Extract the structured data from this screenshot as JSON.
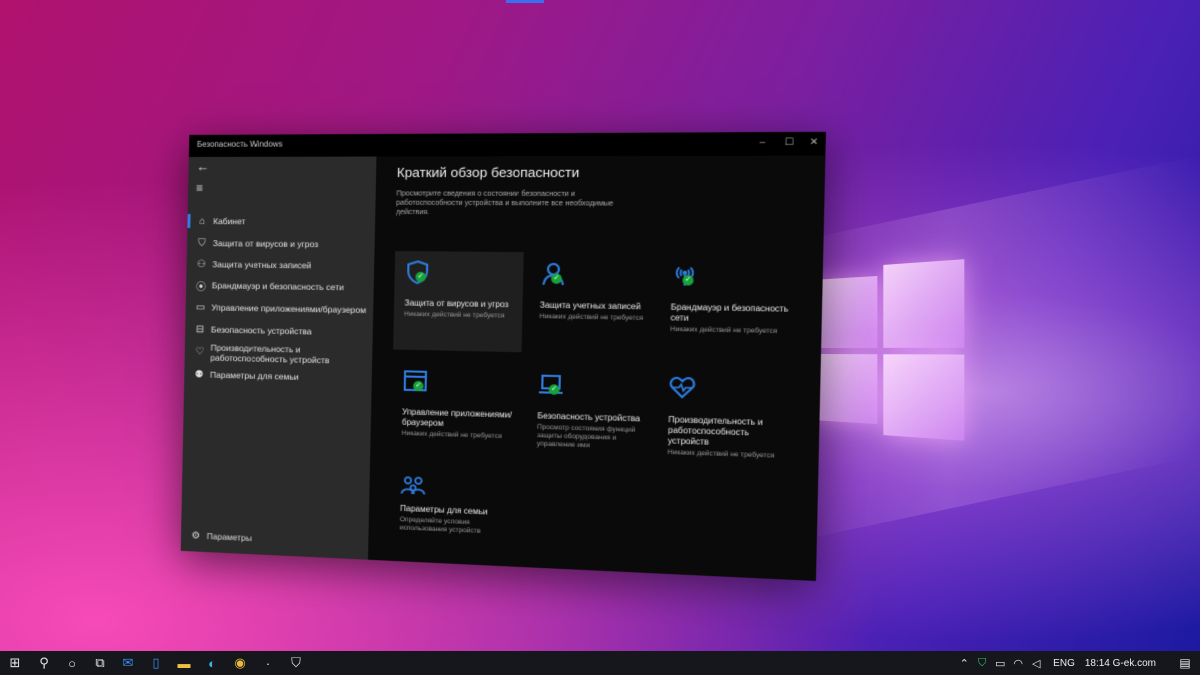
{
  "window": {
    "title": "Безопасность Windows",
    "controls": {
      "minimize": "–",
      "maximize": "☐",
      "close": "✕"
    }
  },
  "sidebar": {
    "back_glyph": "←",
    "menu_glyph": "≡",
    "items": [
      {
        "label": "Кабинет",
        "icon": "home-icon",
        "glyph": "⌂"
      },
      {
        "label": "Защита от вирусов и угроз",
        "icon": "shield-icon",
        "glyph": "⛉"
      },
      {
        "label": "Защита учетных записей",
        "icon": "person-icon",
        "glyph": "⚇"
      },
      {
        "label": "Брандмауэр и безопасность сети",
        "icon": "network-icon",
        "glyph": "⦿"
      },
      {
        "label": "Управление приложениями/браузером",
        "icon": "app-browser-icon",
        "glyph": "▭"
      },
      {
        "label": "Безопасность устройства",
        "icon": "laptop-icon",
        "glyph": "⊟"
      },
      {
        "label": "Производительность и работоспособность устройств",
        "icon": "heart-icon",
        "glyph": "♡"
      },
      {
        "label": "Параметры для семьи",
        "icon": "family-icon",
        "glyph": "⚉"
      }
    ],
    "settings": {
      "label": "Параметры",
      "icon": "gear-icon",
      "glyph": "⚙"
    }
  },
  "main": {
    "title": "Краткий обзор безопасности",
    "description": "Просмотрите сведения о состоянии безопасности и работоспособности устройства и выполните все необходимые действия.",
    "tiles": [
      {
        "title": "Защита от вирусов и угроз",
        "status": "Никаких действий не требуется",
        "icon": "shield-icon"
      },
      {
        "title": "Защита учетных записей",
        "status": "Никаких действий не требуется",
        "icon": "person-icon"
      },
      {
        "title": "Брандмауэр и безопасность сети",
        "status": "Никаких действий не требуется",
        "icon": "network-icon"
      },
      {
        "title": "Управление приложениями/браузером",
        "status": "Никаких действий не требуется",
        "icon": "app-browser-icon"
      },
      {
        "title": "Безопасность устройства",
        "status": "Просмотр состояния функций защиты оборудования и управление ими",
        "icon": "laptop-icon"
      },
      {
        "title": "Производительность и работоспособность устройств",
        "status": "Никаких действий не требуется",
        "icon": "heart-icon"
      },
      {
        "title": "Параметры для семьи",
        "status": "Определяйте условия использования устройств",
        "icon": "family-icon"
      }
    ],
    "check_glyph": "✓"
  },
  "taskbar": {
    "left_icons": [
      {
        "name": "start-icon",
        "glyph": "⊞"
      },
      {
        "name": "search-icon",
        "glyph": "⚲"
      },
      {
        "name": "cortana-icon",
        "glyph": "○"
      },
      {
        "name": "task-view-icon",
        "glyph": "⧉"
      },
      {
        "name": "mail-icon",
        "glyph": "✉"
      },
      {
        "name": "phone-icon",
        "glyph": "▯"
      },
      {
        "name": "file-explorer-icon",
        "glyph": "▬"
      },
      {
        "name": "edge-icon",
        "glyph": "◐"
      },
      {
        "name": "chrome-icon",
        "glyph": "◉"
      },
      {
        "name": "app-dot-icon",
        "glyph": "·"
      },
      {
        "name": "windows-security-icon",
        "glyph": "⛉"
      }
    ],
    "tray_icons": [
      {
        "name": "chevron-up-icon",
        "glyph": "⌃"
      },
      {
        "name": "security-tray-icon",
        "glyph": "⛉"
      },
      {
        "name": "battery-icon",
        "glyph": "▭"
      },
      {
        "name": "wifi-icon",
        "glyph": "◠"
      },
      {
        "name": "volume-icon",
        "glyph": "◁"
      }
    ],
    "language": "ENG",
    "clock": "18:14 G-ek.com",
    "notifications_glyph": "▤"
  },
  "colors": {
    "accent": "#2f7de1",
    "ok": "#17a33b",
    "sidebar": "#2b2b2b"
  }
}
